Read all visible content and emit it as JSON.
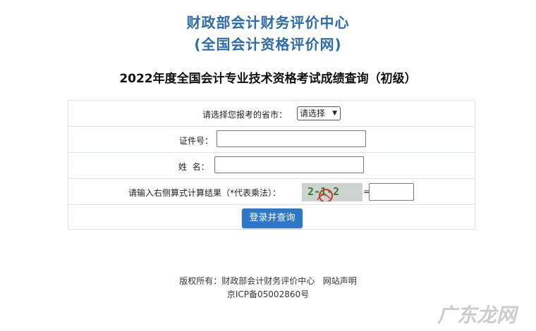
{
  "header": {
    "title_line1": "财政部会计财务评价中心",
    "title_line2": "(全国会计资格评价网)",
    "exam_title": "2022年度全国会计专业技术资格考试成绩查询（初级）"
  },
  "form": {
    "province_label": "请选择您报考的省市：",
    "province_value": "请选择",
    "id_label": "证件号：",
    "name_label": "姓  名：",
    "captcha_label": "请输入右侧算式计算结果（*代表乘法）：",
    "captcha_text": "2-1-2",
    "equals": "=",
    "submit_label": "登录并查询"
  },
  "footer": {
    "copyright": "版权所有：财政部会计财务评价中心",
    "statement_link": "网站声明",
    "icp": "京ICP备05002860号"
  },
  "watermark": "广东龙网",
  "colors": {
    "title": "#2d6ca8",
    "button": "#2e76c8",
    "border": "#dbe4ee"
  }
}
